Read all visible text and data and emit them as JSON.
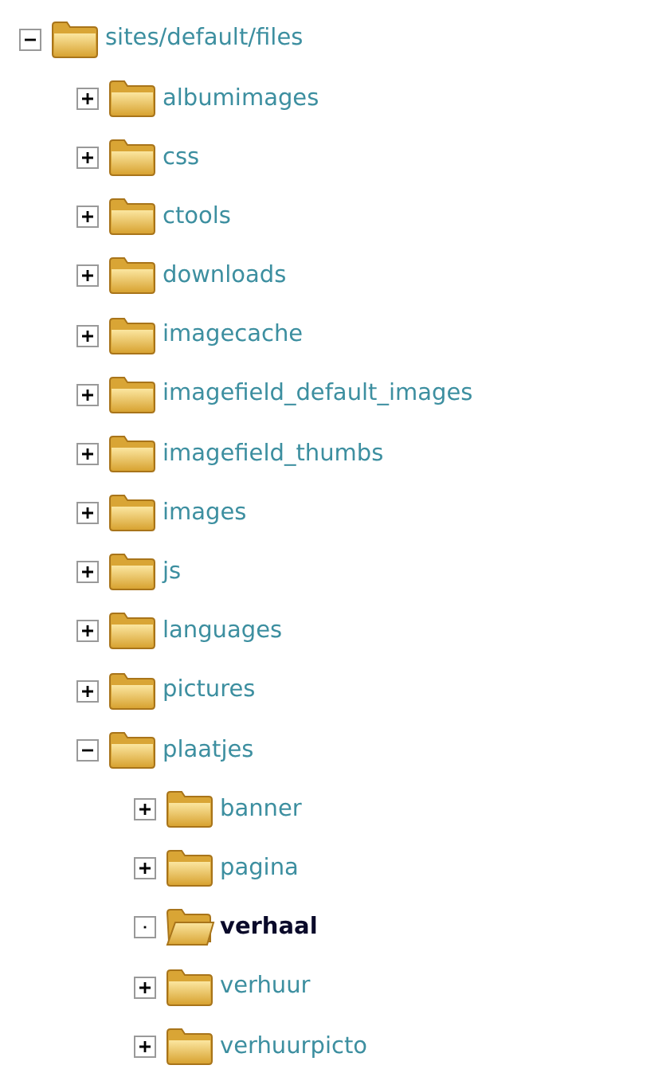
{
  "tree": [
    {
      "label": "sites/default/files",
      "kind": "branch",
      "expanded": true,
      "selected": false,
      "children": [
        {
          "label": "albumimages",
          "kind": "branch",
          "expanded": false,
          "selected": false
        },
        {
          "label": "css",
          "kind": "branch",
          "expanded": false,
          "selected": false
        },
        {
          "label": "ctools",
          "kind": "branch",
          "expanded": false,
          "selected": false
        },
        {
          "label": "downloads",
          "kind": "branch",
          "expanded": false,
          "selected": false
        },
        {
          "label": "imagecache",
          "kind": "branch",
          "expanded": false,
          "selected": false
        },
        {
          "label": "imagefield_default_images",
          "kind": "branch",
          "expanded": false,
          "selected": false
        },
        {
          "label": "imagefield_thumbs",
          "kind": "branch",
          "expanded": false,
          "selected": false
        },
        {
          "label": "images",
          "kind": "branch",
          "expanded": false,
          "selected": false
        },
        {
          "label": "js",
          "kind": "branch",
          "expanded": false,
          "selected": false
        },
        {
          "label": "languages",
          "kind": "branch",
          "expanded": false,
          "selected": false
        },
        {
          "label": "pictures",
          "kind": "branch",
          "expanded": false,
          "selected": false
        },
        {
          "label": "plaatjes",
          "kind": "branch",
          "expanded": true,
          "selected": false,
          "children": [
            {
              "label": "banner",
              "kind": "branch",
              "expanded": false,
              "selected": false
            },
            {
              "label": "pagina",
              "kind": "branch",
              "expanded": false,
              "selected": false
            },
            {
              "label": "verhaal",
              "kind": "leaf",
              "selected": true
            },
            {
              "label": "verhuur",
              "kind": "branch",
              "expanded": false,
              "selected": false
            },
            {
              "label": "verhuurpicto",
              "kind": "branch",
              "expanded": false,
              "selected": false
            }
          ]
        }
      ]
    }
  ]
}
